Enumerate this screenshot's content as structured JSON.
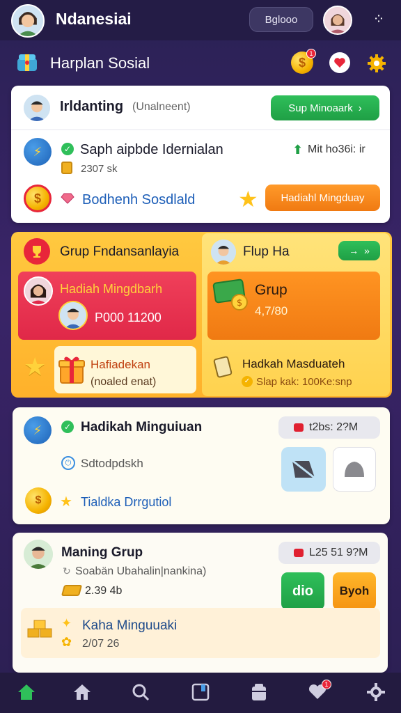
{
  "header": {
    "app_title": "Ndanesiai",
    "pill_button": "Bglooo",
    "menu_icon": "more-dots-icon"
  },
  "subheader": {
    "title": "Harplan Sosial",
    "notification_count": ""
  },
  "card1": {
    "row1": {
      "name": "Irldanting",
      "sub": "(Unalneent)",
      "button": "Sup Minoaark"
    },
    "row2": {
      "title": "Saph aipbde Idernialan",
      "right": "Mit ho36i: ir",
      "amount": "2307 sk"
    },
    "row3": {
      "link": "Bodhenh Sosdlald",
      "button": "Hadiahl Mingduay"
    }
  },
  "yellow_section": {
    "left_header": "Grup  Fndansanlayia",
    "right_header": "Flup Ha",
    "red_tile": {
      "title": "Hadiah Mingdbarh",
      "value": "P000 11200"
    },
    "orange_tile": {
      "title": "Grup",
      "value": "4,7/80"
    },
    "promo_left": {
      "title": "Hafiadekan",
      "sub": "(noaled enat)"
    },
    "promo_right": {
      "title": "Hadkah Masduateh",
      "sub": "Slap kak: 100Ke:snp"
    }
  },
  "card3": {
    "title": "Hadikah Minguiuan",
    "timer": "t2bs: 2?M",
    "row2": "Sdtodpdskh",
    "row3": "Tialdka Drrgutiol"
  },
  "card4": {
    "title": "Maning Grup",
    "timer": "L25 51 9?M",
    "sub": "Soabän Ubahalin|nankina)",
    "amount": "2.39 4b",
    "btn_green": "dio",
    "btn_orange": "Byoh",
    "inner": {
      "title": "Kaha Minguuaki",
      "value": "2/07 26"
    }
  },
  "navbar": {
    "items": [
      "home-icon",
      "house-icon",
      "search-icon",
      "notebook-icon",
      "wallet-icon",
      "heart-icon",
      "settings-icon"
    ],
    "badge": "1"
  },
  "colors": {
    "bg": "#2a2154",
    "green": "#1f9f45",
    "orange": "#f07a12",
    "red": "#e8263a",
    "yellow": "#ffc33a",
    "link_blue": "#1e5fb8"
  }
}
